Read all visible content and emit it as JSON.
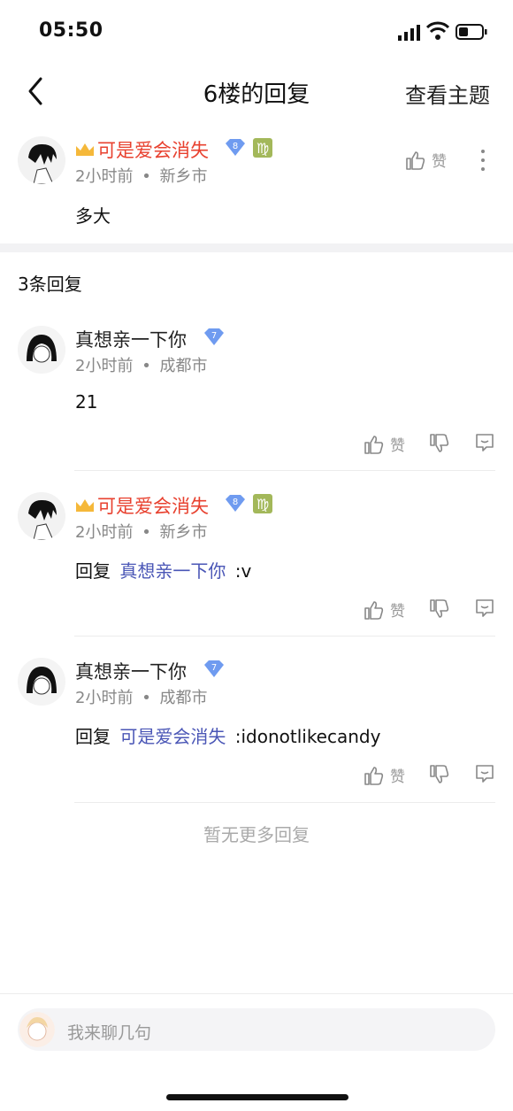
{
  "status_bar": {
    "time": "05:50"
  },
  "nav": {
    "title": "6楼的回复",
    "right_action": "查看主题"
  },
  "main_comment": {
    "username": "可是爱会消失",
    "level": "8",
    "time": "2小时前",
    "location": "新乡市",
    "content": "多大",
    "like_label": "赞"
  },
  "replies_count_label": "3条回复",
  "replies": [
    {
      "username": "真想亲一下你",
      "level": "7",
      "time": "2小时前",
      "location": "成都市",
      "content": "21",
      "reply_prefix": "",
      "reply_target": "",
      "like_label": "赞"
    },
    {
      "username": "可是爱会消失",
      "level": "8",
      "time": "2小时前",
      "location": "新乡市",
      "content": ":v",
      "reply_prefix": "回复",
      "reply_target": "真想亲一下你",
      "like_label": "赞"
    },
    {
      "username": "真想亲一下你",
      "level": "7",
      "time": "2小时前",
      "location": "成都市",
      "content": ":idonotlikecandy",
      "reply_prefix": "回复",
      "reply_target": "可是爱会消失",
      "like_label": "赞"
    }
  ],
  "no_more_label": "暂无更多回复",
  "composer": {
    "placeholder": "我来聊几句"
  },
  "separator_dot": "•",
  "colors": {
    "accent_red": "#e8412f",
    "link": "#4a56b6",
    "virgo_badge": "#a3b85a",
    "level_badge": "#6f9bf0"
  },
  "icons": {
    "like": "thumb-up-icon",
    "dislike": "thumb-down-icon",
    "reply": "comment-bubble-icon",
    "more": "more-vertical-icon"
  }
}
